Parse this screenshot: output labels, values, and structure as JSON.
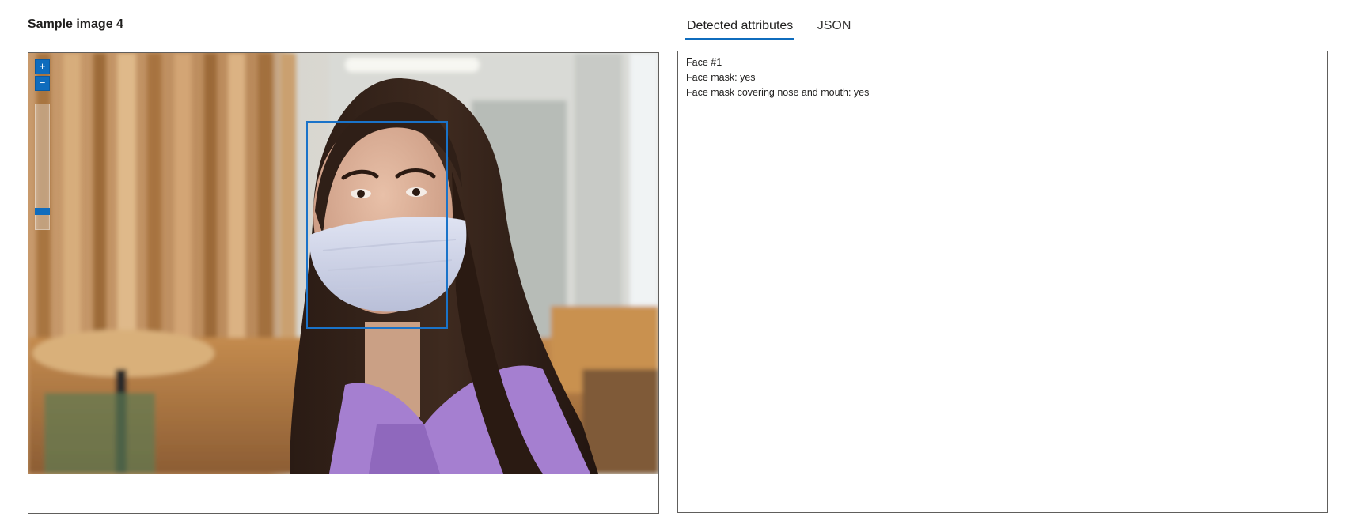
{
  "left_panel": {
    "title": "Sample image 4",
    "zoom_in_label": "+",
    "zoom_out_label": "−",
    "zoom_level": 0.12
  },
  "tabs": [
    {
      "label": "Detected attributes",
      "active": true
    },
    {
      "label": "JSON",
      "active": false
    }
  ],
  "results": {
    "lines": [
      "Face #1",
      "Face mask: yes",
      "Face mask covering nose and mouth: yes"
    ]
  },
  "colors": {
    "accent": "#0f6cbd",
    "face_box": "#1a73c9",
    "border": "#605e5c"
  }
}
